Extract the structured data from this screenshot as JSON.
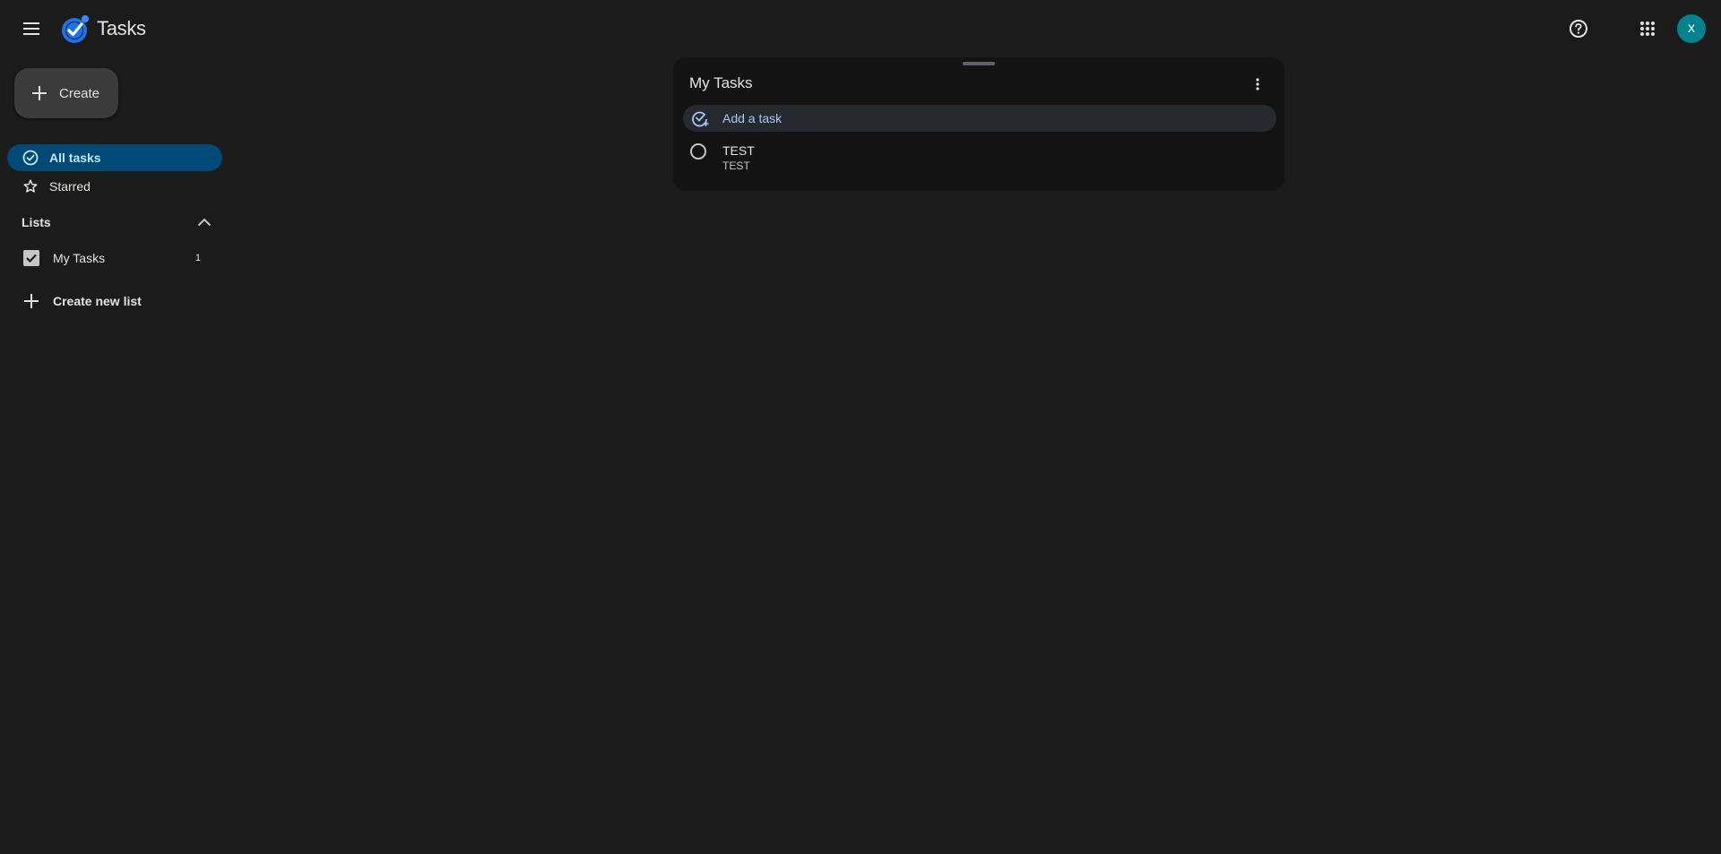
{
  "header": {
    "app_title": "Tasks",
    "avatar_initial": "x",
    "icons": {
      "menu": "hamburger-menu-icon",
      "logo": "tasks-logo-icon",
      "help": "help-icon",
      "apps": "apps-grid-icon"
    }
  },
  "sidebar": {
    "create_label": "Create",
    "nav": [
      {
        "label": "All tasks",
        "icon": "check-circle-icon",
        "active": true
      },
      {
        "label": "Starred",
        "icon": "star-icon",
        "active": false
      }
    ],
    "lists_label": "Lists",
    "lists": [
      {
        "label": "My Tasks",
        "count": "1",
        "checked": true
      }
    ],
    "create_list_label": "Create new list"
  },
  "main": {
    "card": {
      "title": "My Tasks",
      "add_task_label": "Add a task",
      "tasks": [
        {
          "title": "TEST",
          "details": "TEST"
        }
      ]
    }
  },
  "colors": {
    "background": "#1b1b1b",
    "card": "#131313",
    "active_nav": "#004a77",
    "accent_text": "#a8c7fa",
    "avatar": "#00838f"
  }
}
